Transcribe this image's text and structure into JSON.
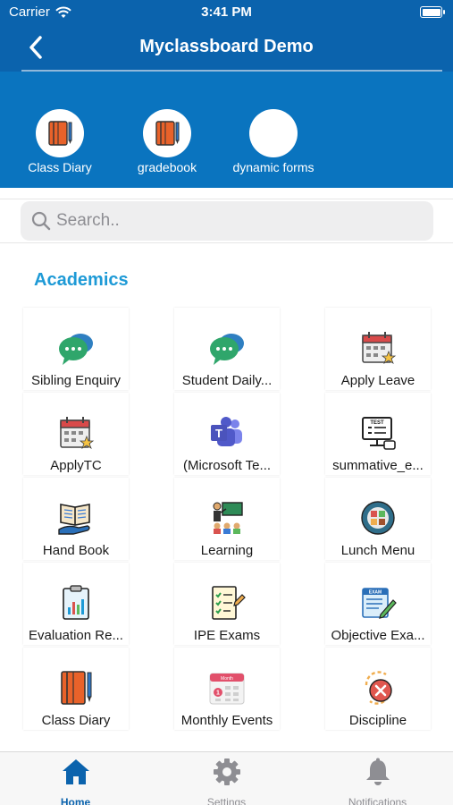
{
  "status_bar": {
    "carrier": "Carrier",
    "time": "3:41 PM"
  },
  "nav": {
    "title": "Myclassboard Demo"
  },
  "shortcuts": [
    {
      "label": "Class Diary",
      "icon": "notebook-icon"
    },
    {
      "label": "gradebook",
      "icon": "notebook-icon"
    },
    {
      "label": "dynamic forms",
      "icon": "blank-icon"
    }
  ],
  "search": {
    "placeholder": "Search.."
  },
  "section": {
    "title": "Academics"
  },
  "tiles": [
    {
      "label": "Sibling Enquiry",
      "icon": "chat-bubbles-icon"
    },
    {
      "label": "Student Daily...",
      "icon": "chat-bubbles-icon"
    },
    {
      "label": "Apply Leave",
      "icon": "calendar-star-icon"
    },
    {
      "label": "ApplyTC",
      "icon": "calendar-star-icon"
    },
    {
      "label": "(Microsoft Te...",
      "icon": "teams-icon"
    },
    {
      "label": "summative_e...",
      "icon": "online-test-icon"
    },
    {
      "label": "Hand Book",
      "icon": "book-hand-icon"
    },
    {
      "label": "Learning",
      "icon": "classroom-icon"
    },
    {
      "label": "Lunch Menu",
      "icon": "lunch-plate-icon"
    },
    {
      "label": "Evaluation Re...",
      "icon": "report-clipboard-icon"
    },
    {
      "label": "IPE Exams",
      "icon": "exam-checklist-icon"
    },
    {
      "label": "Objective Exa...",
      "icon": "exam-pencil-icon"
    },
    {
      "label": "Class Diary",
      "icon": "notebook-icon"
    },
    {
      "label": "Monthly Events",
      "icon": "monthly-calendar-icon"
    },
    {
      "label": "Discipline",
      "icon": "discipline-icon"
    }
  ],
  "tabbar": [
    {
      "label": "Home",
      "icon": "home-icon",
      "active": true
    },
    {
      "label": "Settings",
      "icon": "gear-icon",
      "active": false
    },
    {
      "label": "Notifications",
      "icon": "bell-icon",
      "active": false
    }
  ],
  "colors": {
    "primary": "#0b63ad",
    "band": "#0a74bf",
    "section": "#1e9ad6"
  }
}
